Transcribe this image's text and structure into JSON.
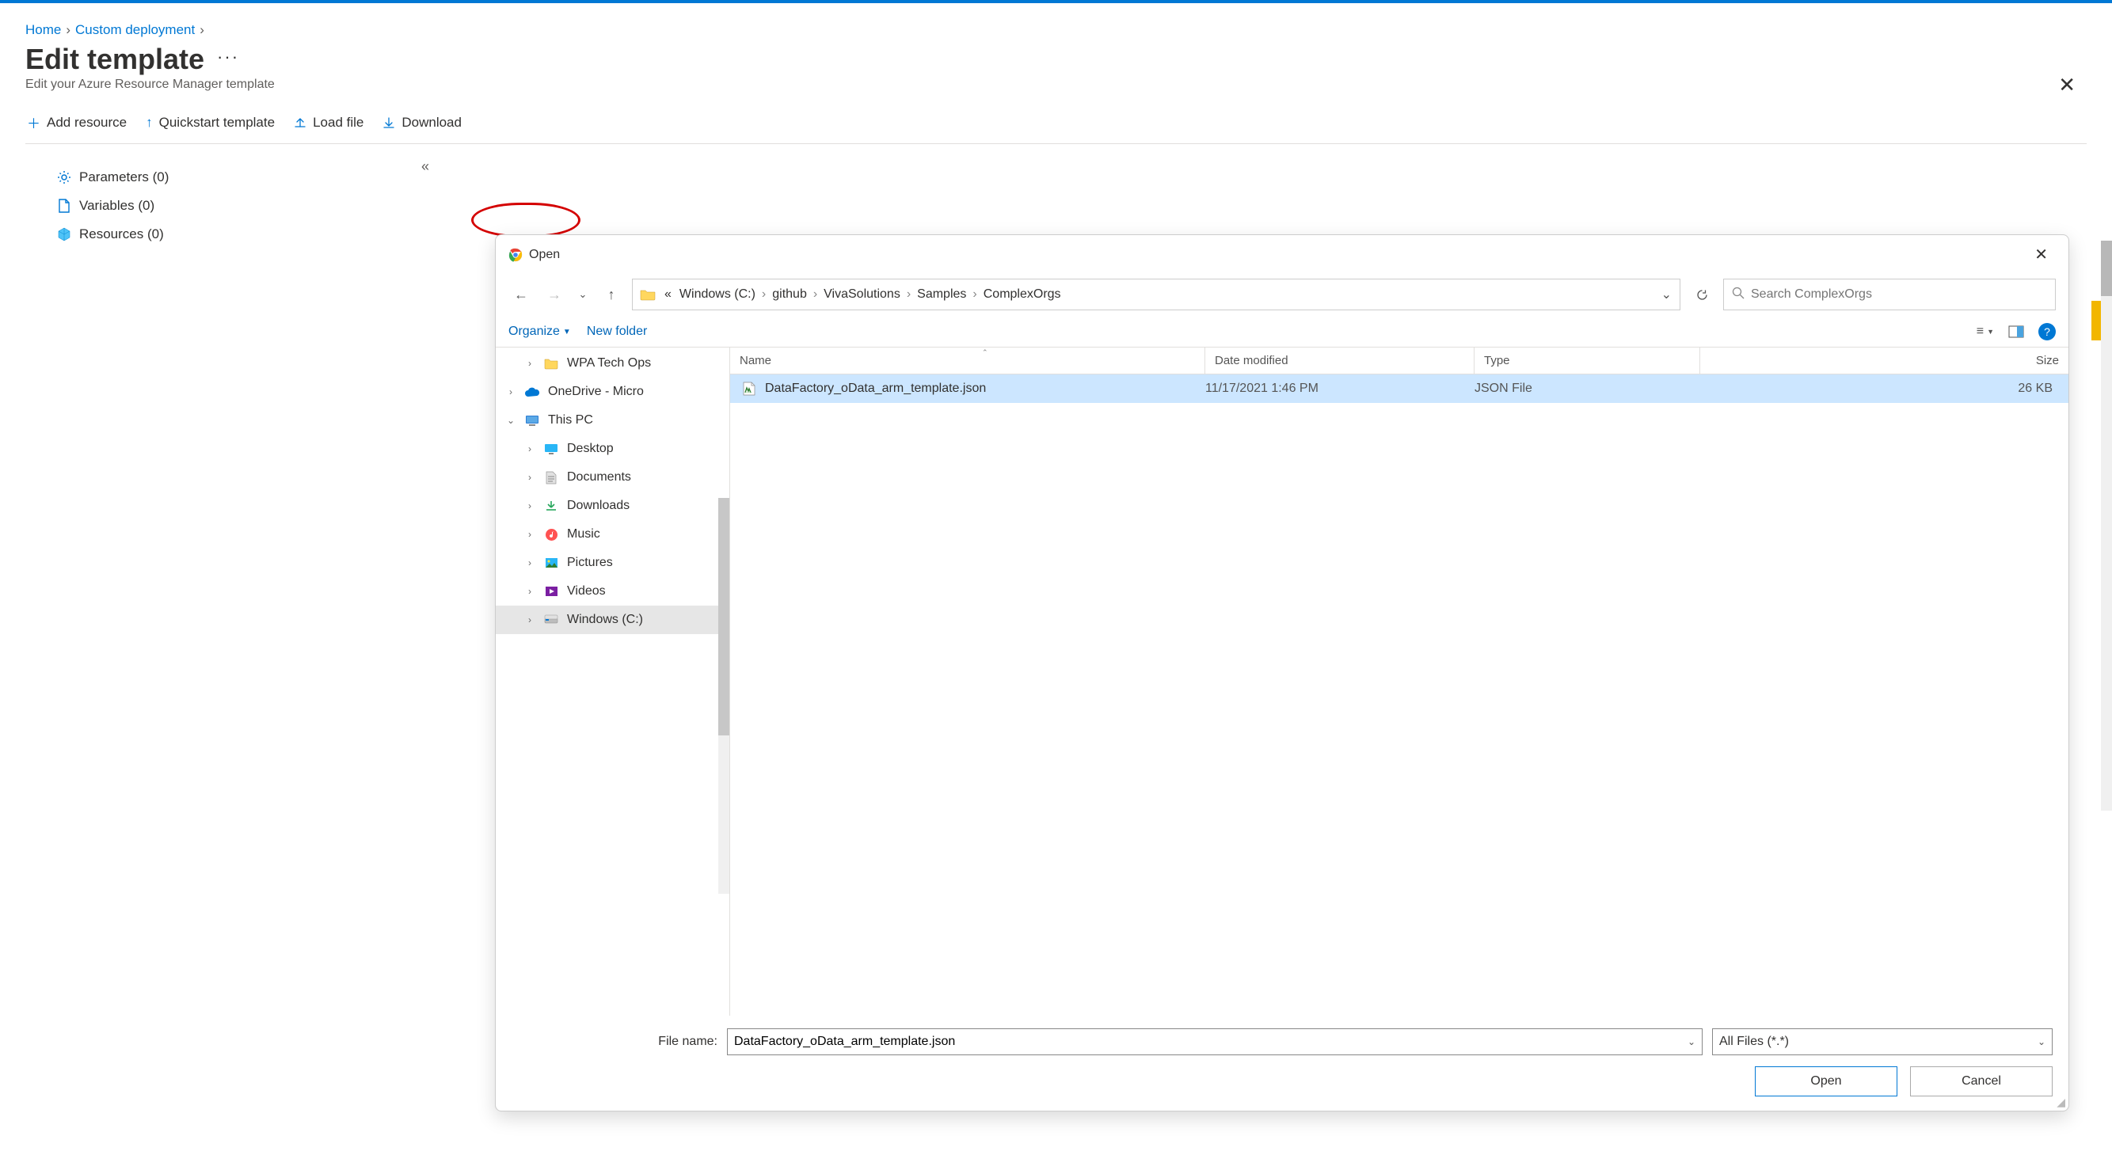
{
  "breadcrumb": {
    "home": "Home",
    "custom": "Custom deployment"
  },
  "page": {
    "title": "Edit template",
    "subtitle": "Edit your Azure Resource Manager template"
  },
  "toolbar": {
    "add": "Add resource",
    "quick": "Quickstart template",
    "load": "Load file",
    "download": "Download"
  },
  "tree": {
    "parameters": "Parameters (0)",
    "variables": "Variables (0)",
    "resources": "Resources (0)"
  },
  "dialog": {
    "title": "Open",
    "path": {
      "parts": [
        "Windows (C:)",
        "github",
        "VivaSolutions",
        "Samples",
        "ComplexOrgs"
      ]
    },
    "search_placeholder": "Search ComplexOrgs",
    "organize": "Organize",
    "newfolder": "New folder",
    "cols": {
      "name": "Name",
      "date": "Date modified",
      "type": "Type",
      "size": "Size"
    },
    "navtree": [
      {
        "label": "WPA Tech Ops",
        "icon": "folder",
        "level": 2,
        "expand": ">"
      },
      {
        "label": "OneDrive - Micro",
        "icon": "onedrive",
        "level": 1,
        "expand": ">"
      },
      {
        "label": "This PC",
        "icon": "thispc",
        "level": 1,
        "expand": "v"
      },
      {
        "label": "Desktop",
        "icon": "desktop",
        "level": 2,
        "expand": ">"
      },
      {
        "label": "Documents",
        "icon": "doc",
        "level": 2,
        "expand": ">"
      },
      {
        "label": "Downloads",
        "icon": "download",
        "level": 2,
        "expand": ">"
      },
      {
        "label": "Music",
        "icon": "music",
        "level": 2,
        "expand": ">"
      },
      {
        "label": "Pictures",
        "icon": "picture",
        "level": 2,
        "expand": ">"
      },
      {
        "label": "Videos",
        "icon": "video",
        "level": 2,
        "expand": ">"
      },
      {
        "label": "Windows (C:)",
        "icon": "drive",
        "level": 2,
        "expand": ">",
        "selected": true
      }
    ],
    "files": [
      {
        "name": "DataFactory_oData_arm_template.json",
        "date": "11/17/2021 1:46 PM",
        "type": "JSON File",
        "size": "26 KB",
        "selected": true
      }
    ],
    "filename_label": "File name:",
    "filename_value": "DataFactory_oData_arm_template.json",
    "filetype_value": "All Files (*.*)",
    "open_btn": "Open",
    "cancel_btn": "Cancel"
  }
}
